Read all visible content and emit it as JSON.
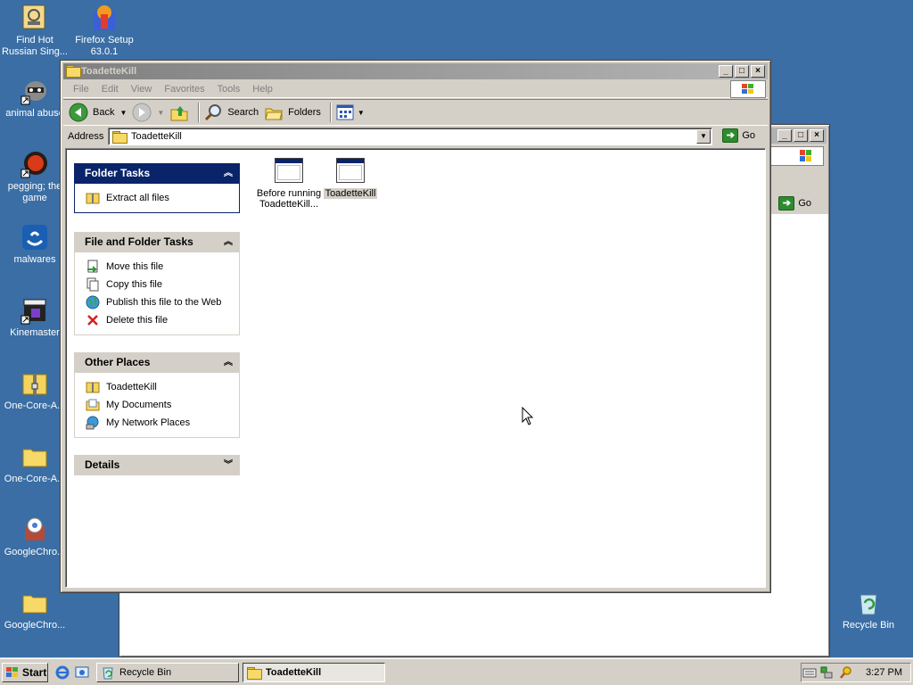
{
  "desktop": {
    "icons": [
      {
        "label1": "Find Hot",
        "label2": "Russian Sing...",
        "icon": "sync-icon"
      },
      {
        "label1": "Firefox Setup",
        "label2": "63.0.1",
        "icon": "firefox-setup-icon"
      },
      {
        "label1": "animal abuse",
        "label2": "",
        "icon": "raccoon-shortcut-icon"
      },
      {
        "label1": "pegging; the",
        "label2": "game",
        "icon": "red-button-shortcut-icon"
      },
      {
        "label1": "malwares",
        "label2": "",
        "icon": "malwares-app-icon"
      },
      {
        "label1": "Kinemaster",
        "label2": "",
        "icon": "clapper-shortcut-icon"
      },
      {
        "label1": "One-Core-A...",
        "label2": "",
        "icon": "zip-folder-icon"
      },
      {
        "label1": "One-Core-A...",
        "label2": "",
        "icon": "folder-icon"
      },
      {
        "label1": "GoogleChro...",
        "label2": "",
        "icon": "chrome-installer-icon"
      },
      {
        "label1": "GoogleChro...",
        "label2": "",
        "icon": "folder-icon"
      },
      {
        "label1": "Recycle Bin",
        "label2": "",
        "icon": "recycle-bin-icon"
      }
    ]
  },
  "background_window": {
    "go_label": "Go"
  },
  "window": {
    "title": "ToadetteKill",
    "menu": [
      "File",
      "Edit",
      "View",
      "Favorites",
      "Tools",
      "Help"
    ],
    "toolbar": {
      "back_label": "Back",
      "search_label": "Search",
      "folders_label": "Folders"
    },
    "address": {
      "label": "Address",
      "value": "ToadetteKill",
      "go_label": "Go"
    },
    "folder_tasks": {
      "title": "Folder Tasks",
      "items": [
        "Extract all files"
      ]
    },
    "file_folder_tasks": {
      "title": "File and Folder Tasks",
      "items": [
        "Move this file",
        "Copy this file",
        "Publish this file to the Web",
        "Delete this file"
      ]
    },
    "other_places": {
      "title": "Other Places",
      "items": [
        "ToadetteKill",
        "My Documents",
        "My Network Places"
      ]
    },
    "details": {
      "title": "Details"
    },
    "files": [
      {
        "line1": "Before running",
        "line2": "ToadetteKill..."
      },
      {
        "line1": "ToadetteKill",
        "line2": ""
      }
    ]
  },
  "taskbar": {
    "start_label": "Start",
    "tasks": [
      "Recycle Bin",
      "ToadetteKill"
    ],
    "clock": "3:27 PM"
  },
  "colors": {
    "desktop": "#3a6ea5",
    "selected_title": "#0a246a",
    "inactive_title": "#808080"
  }
}
